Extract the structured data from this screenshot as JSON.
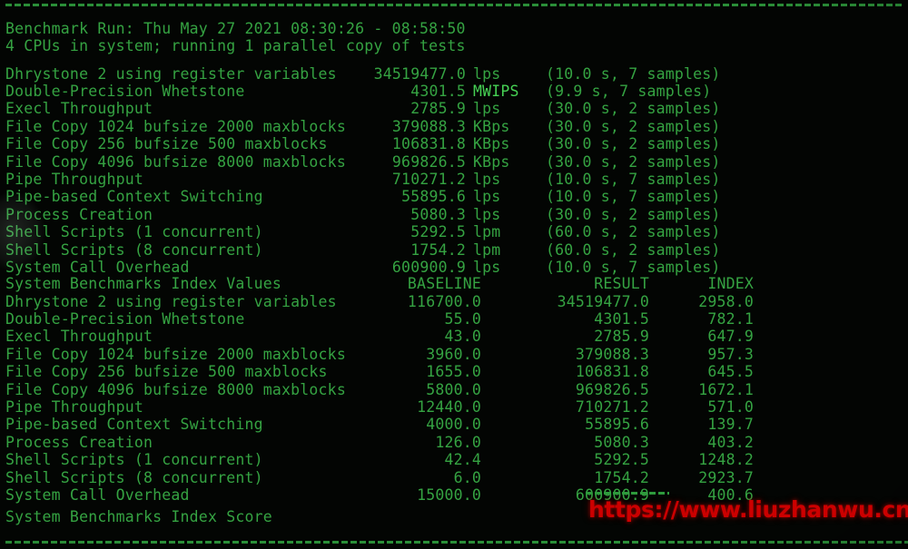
{
  "terminal": {
    "colors": {
      "background": "#030503",
      "text_green": "#35a342",
      "bright_green": "#46d154",
      "watermark_red": "#cc0000"
    },
    "separator_top": "------------------------------------------------------------------------",
    "separator_bottom": "------------------------------------------------------------------------",
    "score_separator": "========"
  },
  "header": {
    "benchmark_run": "Benchmark Run: Thu May 27 2021 08:30:26 - 08:58:50",
    "cpu_line": "4 CPUs in system; running 1 parallel copy of tests"
  },
  "raw_results": [
    {
      "label": "Dhrystone 2 using register variables",
      "value": "34519477.0",
      "unit": "lps",
      "samples": "(10.0 s, 7 samples)"
    },
    {
      "label": "Double-Precision Whetstone",
      "value": "4301.5",
      "unit": "MWIPS",
      "samples": "(9.9 s, 7 samples)"
    },
    {
      "label": "Execl Throughput",
      "value": "2785.9",
      "unit": "lps",
      "samples": "(30.0 s, 2 samples)"
    },
    {
      "label": "File Copy 1024 bufsize 2000 maxblocks",
      "value": "379088.3",
      "unit": "KBps",
      "samples": "(30.0 s, 2 samples)"
    },
    {
      "label": "File Copy 256 bufsize 500 maxblocks",
      "value": "106831.8",
      "unit": "KBps",
      "samples": "(30.0 s, 2 samples)"
    },
    {
      "label": "File Copy 4096 bufsize 8000 maxblocks",
      "value": "969826.5",
      "unit": "KBps",
      "samples": "(30.0 s, 2 samples)"
    },
    {
      "label": "Pipe Throughput",
      "value": "710271.2",
      "unit": "lps",
      "samples": "(10.0 s, 7 samples)"
    },
    {
      "label": "Pipe-based Context Switching",
      "value": "55895.6",
      "unit": "lps",
      "samples": "(10.0 s, 7 samples)"
    },
    {
      "label": "Process Creation",
      "value": "5080.3",
      "unit": "lps",
      "samples": "(30.0 s, 2 samples)"
    },
    {
      "label": "Shell Scripts (1 concurrent)",
      "value": "5292.5",
      "unit": "lpm",
      "samples": "(60.0 s, 2 samples)"
    },
    {
      "label": "Shell Scripts (8 concurrent)",
      "value": "1754.2",
      "unit": "lpm",
      "samples": "(60.0 s, 2 samples)"
    },
    {
      "label": "System Call Overhead",
      "value": "600900.9",
      "unit": "lps",
      "samples": "(10.0 s, 7 samples)"
    }
  ],
  "index_table": {
    "title": "System Benchmarks Index Values",
    "columns": {
      "baseline": "BASELINE",
      "result": "RESULT",
      "index": "INDEX"
    },
    "rows": [
      {
        "label": "Dhrystone 2 using register variables",
        "baseline": "116700.0",
        "result": "34519477.0",
        "index": "2958.0"
      },
      {
        "label": "Double-Precision Whetstone",
        "baseline": "55.0",
        "result": "4301.5",
        "index": "782.1"
      },
      {
        "label": "Execl Throughput",
        "baseline": "43.0",
        "result": "2785.9",
        "index": "647.9"
      },
      {
        "label": "File Copy 1024 bufsize 2000 maxblocks",
        "baseline": "3960.0",
        "result": "379088.3",
        "index": "957.3"
      },
      {
        "label": "File Copy 256 bufsize 500 maxblocks",
        "baseline": "1655.0",
        "result": "106831.8",
        "index": "645.5"
      },
      {
        "label": "File Copy 4096 bufsize 8000 maxblocks",
        "baseline": "5800.0",
        "result": "969826.5",
        "index": "1672.1"
      },
      {
        "label": "Pipe Throughput",
        "baseline": "12440.0",
        "result": "710271.2",
        "index": "571.0"
      },
      {
        "label": "Pipe-based Context Switching",
        "baseline": "4000.0",
        "result": "55895.6",
        "index": "139.7"
      },
      {
        "label": "Process Creation",
        "baseline": "126.0",
        "result": "5080.3",
        "index": "403.2"
      },
      {
        "label": "Shell Scripts (1 concurrent)",
        "baseline": "42.4",
        "result": "5292.5",
        "index": "1248.2"
      },
      {
        "label": "Shell Scripts (8 concurrent)",
        "baseline": "6.0",
        "result": "1754.2",
        "index": "2923.7"
      },
      {
        "label": "System Call Overhead",
        "baseline": "15000.0",
        "result": "600900.9",
        "index": "400.6"
      }
    ]
  },
  "score": {
    "label": "System Benchmarks Index Score",
    "value": ""
  },
  "watermark": {
    "text": "https://www.liuzhanwu.cn"
  }
}
